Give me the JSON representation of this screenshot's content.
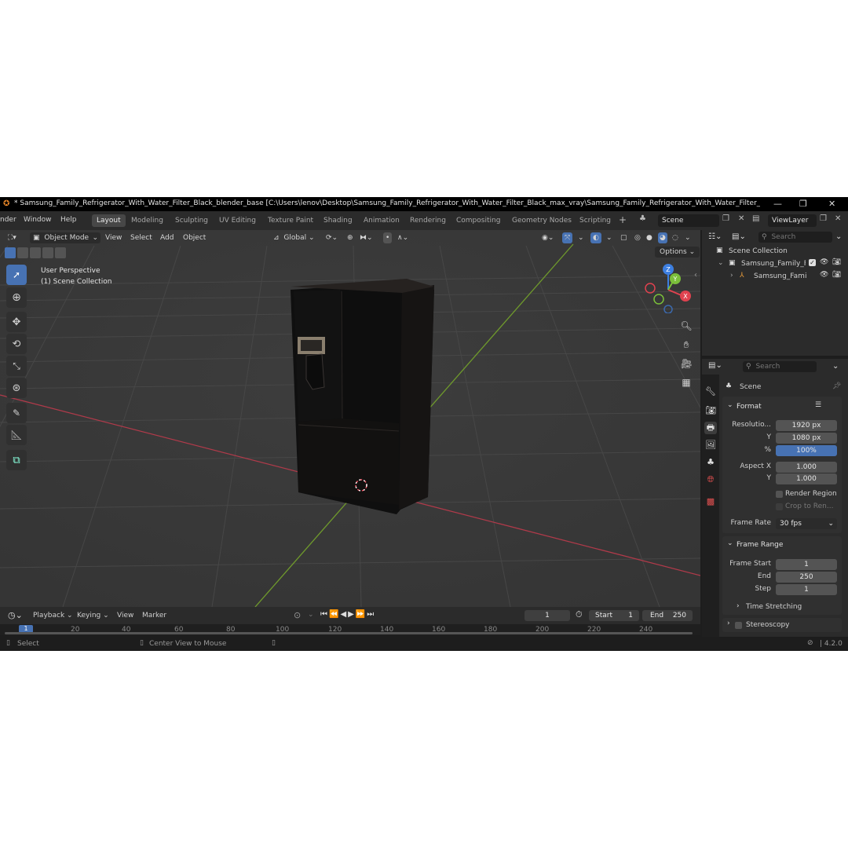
{
  "window": {
    "title": "* Samsung_Family_Refrigerator_With_Water_Filter_Black_blender_base [C:\\Users\\lenov\\Desktop\\Samsung_Family_Refrigerator_With_Water_Filter_Black_max_vray\\Samsung_Family_Refrigerator_With_Water_Filter_Black_blender...",
    "minimize": "—",
    "maximize": "❐",
    "close": "✕"
  },
  "menubar": {
    "items": [
      "nder",
      "Window",
      "Help"
    ],
    "workspaces": [
      "Layout",
      "Modeling",
      "Sculpting",
      "UV Editing",
      "Texture Paint",
      "Shading",
      "Animation",
      "Rendering",
      "Compositing",
      "Geometry Nodes",
      "Scripting"
    ],
    "add_tab": "+",
    "scene": "Scene",
    "view_layer": "ViewLayer"
  },
  "viewport": {
    "mode": "Object Mode",
    "menus": [
      "View",
      "Select",
      "Add",
      "Object"
    ],
    "transform": "Global",
    "options": "Options",
    "overlay_line1": "User Perspective",
    "overlay_line2": "(1) Scene Collection",
    "gizmo": {
      "x": "X",
      "y": "Y",
      "z": "Z"
    }
  },
  "outliner": {
    "search_placeholder": "Search",
    "root": "Scene Collection",
    "collection": "Samsung_Family_F",
    "object": "Samsung_Fami"
  },
  "properties": {
    "search_placeholder": "Search",
    "context": "Scene",
    "format": {
      "header": "Format",
      "resolution_label": "Resolutio...",
      "res_x": "1920 px",
      "y_label": "Y",
      "res_y": "1080 px",
      "pct_label": "%",
      "pct": "100%",
      "aspect_label": "Aspect X",
      "aspect_x": "1.000",
      "aspect_y_label": "Y",
      "aspect_y": "1.000",
      "render_region": "Render Region",
      "crop": "Crop to Ren...",
      "frame_rate_label": "Frame Rate",
      "frame_rate": "30 fps"
    },
    "frame_range": {
      "header": "Frame Range",
      "start_label": "Frame Start",
      "start": "1",
      "end_label": "End",
      "end": "250",
      "step_label": "Step",
      "step": "1"
    },
    "time_stretching": "Time Stretching",
    "stereoscopy": "Stereoscopy"
  },
  "timeline": {
    "menus": [
      "Playback",
      "Keying",
      "View",
      "Marker"
    ],
    "current_frame": "1",
    "start_label": "Start",
    "start": "1",
    "end_label": "End",
    "end": "250",
    "ruler": [
      "1",
      "20",
      "40",
      "60",
      "80",
      "100",
      "120",
      "140",
      "160",
      "180",
      "200",
      "220",
      "240"
    ]
  },
  "statusbar": {
    "select": "Select",
    "center": "Center View to Mouse",
    "version": "4.2.0"
  },
  "colors": {
    "accent": "#4772b3",
    "axis_red": "#b03a4a",
    "axis_green": "#6f9a2c",
    "gizmo_x": "#e0424f",
    "gizmo_y": "#7bbf3a",
    "gizmo_z": "#3d7fe0"
  }
}
